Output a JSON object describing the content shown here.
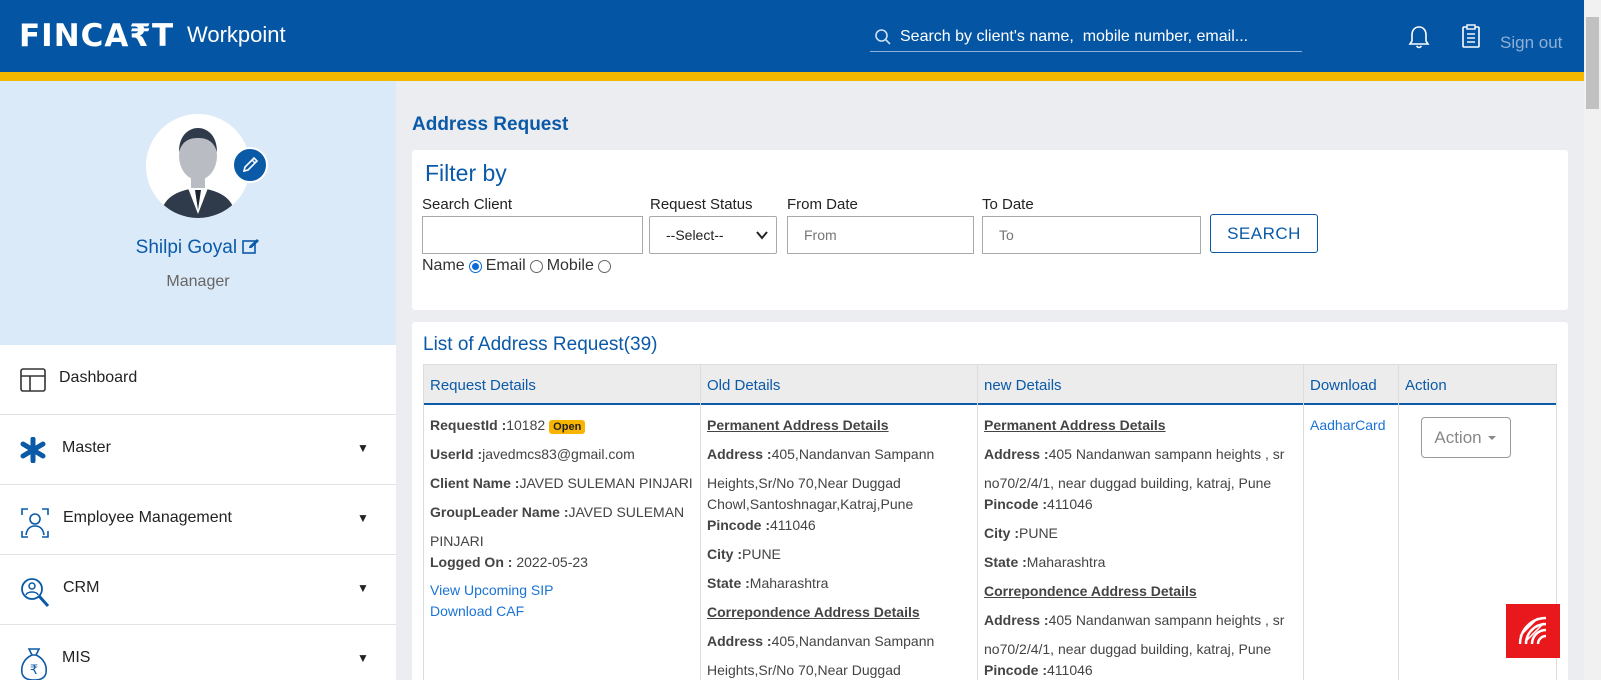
{
  "header": {
    "logo_text": "FINCA₹T",
    "logo_sub": "Workpoint",
    "search_placeholder": "Search by client's name,  mobile number, email...",
    "sign_out": "Sign out",
    "bell_icon": "bell-icon",
    "clipboard_icon": "clipboard-icon"
  },
  "colors": {
    "header_bg": "#0455a4",
    "header_stripe": "#f5b800",
    "accent": "#0a5aa8",
    "badge": "#f7b400",
    "float_button": "#e8181c"
  },
  "profile": {
    "name": "Shilpi Goyal",
    "role": "Manager"
  },
  "sidebar": {
    "items": [
      {
        "label": "Dashboard",
        "icon": "dashboard-icon"
      },
      {
        "label": "Master",
        "icon": "asterisk-icon"
      },
      {
        "label": "Employee Management",
        "icon": "employee-icon"
      },
      {
        "label": "CRM",
        "icon": "crm-icon"
      },
      {
        "label": "MIS",
        "icon": "money-bag-icon"
      }
    ]
  },
  "main": {
    "title": "Address Request",
    "filter": {
      "title": "Filter by",
      "search_client_label": "Search Client",
      "status_label": "Request Status",
      "status_value": "--Select--",
      "from_label": "From Date",
      "from_placeholder": "From",
      "to_label": "To Date",
      "to_placeholder": "To",
      "search_button": "SEARCH",
      "radio_name": "Name",
      "radio_email": "Email",
      "radio_mobile": "Mobile",
      "selected": "Name"
    },
    "list": {
      "title": "List of Address Request(39)",
      "columns": [
        "Request Details",
        "Old Details",
        "new Details",
        "Download",
        "Action"
      ],
      "row": {
        "request_id_label": "RequestId :",
        "request_id": "10182",
        "status_badge": "Open",
        "user_id_label": "UserId :",
        "user_id": "javedmcs83@gmail.com",
        "client_name_label": "Client Name :",
        "client_name": "JAVED SULEMAN PINJARI",
        "group_leader_label": "GroupLeader Name :",
        "group_leader_1": "JAVED SULEMAN",
        "group_leader_2": "PINJARI",
        "logged_on_label": "Logged On :",
        "logged_on": " 2022-05-23",
        "view_sip": "View Upcoming SIP",
        "download_caf": "Download CAF",
        "old": {
          "perm_heading": "Permanent Address Details",
          "address_label": "Address :",
          "address_1": "405,Nandanvan Sampann",
          "address_2": "Heights,Sr/No 70,Near Duggad",
          "address_3": "Chowl,Santoshnagar,Katraj,Pune",
          "pincode_label": "Pincode :",
          "pincode": "411046",
          "city_label": "City :",
          "city": "PUNE",
          "state_label": "State :",
          "state": "Maharashtra",
          "corr_heading": "Correpondence Address Details",
          "corr_address_1": "405,Nandanvan Sampann",
          "corr_address_2": "Heights,Sr/No 70,Near Duggad"
        },
        "new": {
          "perm_heading": "Permanent Address Details",
          "address_label": "Address :",
          "address_1": "405 Nandanwan sampann heights , sr",
          "address_2": "no70/2/4/1, near duggad building, katraj, Pune",
          "pincode_label": "Pincode :",
          "pincode": "411046",
          "city_label": "City :",
          "city": "PUNE",
          "state_label": "State :",
          "state": "Maharashtra",
          "corr_heading": "Correpondence Address Details",
          "corr_address_1": "405 Nandanwan sampann heights , sr",
          "corr_address_2": "no70/2/4/1, near duggad building, katraj, Pune",
          "corr_pincode": "411046"
        },
        "download_link": "AadharCard",
        "action_button": "Action"
      }
    }
  }
}
